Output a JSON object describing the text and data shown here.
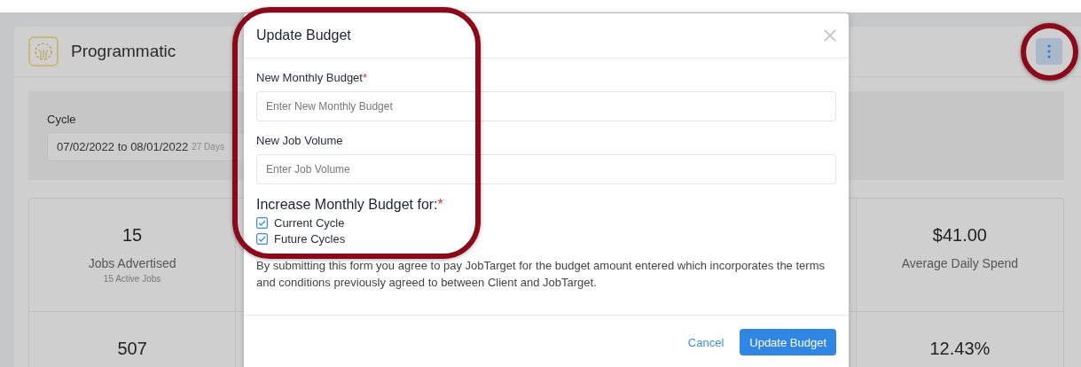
{
  "page": {
    "title": "Programmatic",
    "cycle": {
      "label": "Cycle",
      "value": "07/02/2022 to 08/01/2022",
      "note": "27 Days"
    },
    "stats": [
      {
        "column_1": {
          "value": "15",
          "label": "Jobs Advertised",
          "sub": "15 Active Jobs"
        },
        "column_5": {
          "value": "$41.00",
          "label": "Average Daily Spend"
        }
      },
      {
        "column_1": {
          "value": "507"
        },
        "column_5": {
          "value": "12.43%"
        }
      }
    ]
  },
  "modal": {
    "title": "Update Budget",
    "fields": [
      {
        "label": "New Monthly Budget",
        "required_mark": "*",
        "placeholder": "Enter New Monthly Budget"
      },
      {
        "label": "New Job Volume",
        "placeholder": "Enter Job Volume"
      }
    ],
    "options_title": "Increase Monthly Budget for:",
    "options_required_mark": "*",
    "options": [
      {
        "label": "Current Cycle",
        "checked": true
      },
      {
        "label": "Future Cycles",
        "checked": true
      }
    ],
    "notice": "By submitting this form you agree to pay JobTarget for the budget amount entered which incorporates the terms and conditions previously agreed to between Client and JobTarget.",
    "buttons": [
      {
        "label": "Cancel",
        "kind": "link"
      },
      {
        "label": "Update Budget",
        "kind": "primary"
      }
    ]
  }
}
